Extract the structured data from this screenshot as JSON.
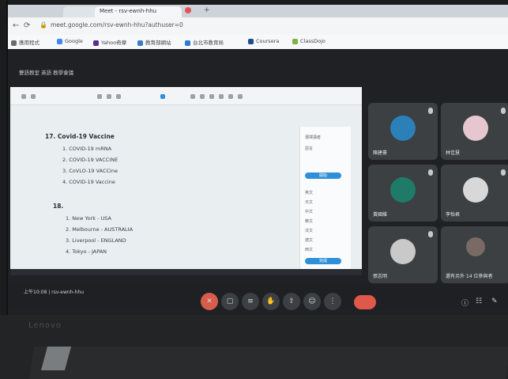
{
  "browser": {
    "tabs": [
      "",
      "Meet - rsv-ewnh-hhu"
    ],
    "url": "meet.google.com/rsv-ewnh-hhu?authuser=0",
    "bookmarks": [
      "應用程式",
      "Google",
      "Yahoo奇摩",
      "教育部網站",
      "台北市教育局",
      "Coursera",
      "ClassDojo"
    ]
  },
  "meet": {
    "title": "雙語教室 英語 教學會議",
    "document": {
      "heading": "17. Covid-19 Vaccine",
      "vaccine_items": [
        "1. COVID-19 mRNA",
        "2. COVID-19 VACCINE",
        "3. CoVLO-19 VACCine",
        "4. COVID-19 Vaccine"
      ],
      "section_number": "18.",
      "city_items": [
        "1. New York - USA",
        "2. Melbourne - AUSTRALIA",
        "3. Liverpool - ENGLAND",
        "4. Tokyo - JAPAN"
      ]
    },
    "side_panel": {
      "rows": [
        "選擇講者",
        "語言",
        "英文",
        "日文",
        "中文",
        "韓文",
        "法文",
        "德文",
        "西文"
      ],
      "buttons": [
        "開始",
        "完成"
      ]
    },
    "participants": [
      {
        "name": "陳建豪",
        "avatar_color": "#2b80b8"
      },
      {
        "name": "林佳慧",
        "avatar_color": "#e7c7cf"
      },
      {
        "name": "黃國維",
        "avatar_color": "#1f7a68"
      },
      {
        "name": "李怡君",
        "avatar_color": "#d8d8d8"
      },
      {
        "name": "張志明",
        "avatar_color": "#c9c9c9"
      },
      {
        "name": "還有另外 14 位參與者",
        "avatar_color": "#7a6a66"
      }
    ],
    "meeting_info": "上午10:08 | rsv-ewnh-hhu",
    "controls": [
      "mic-off",
      "camera",
      "captions",
      "raise-hand",
      "present",
      "more",
      "leave"
    ]
  },
  "laptop": {
    "brand": "Lenovo"
  },
  "colors": {
    "meet_bg": "#202124",
    "tile_bg": "#3c4043",
    "leave_red": "#e0584a",
    "accent_blue": "#2f8fd8"
  }
}
